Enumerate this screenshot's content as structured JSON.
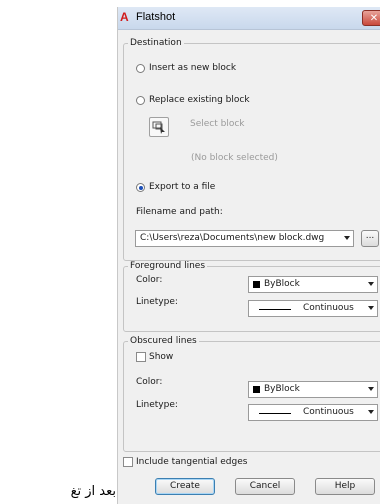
{
  "window": {
    "title": "Flatshot",
    "app_icon": "autocad-icon",
    "close_icon": "close-icon"
  },
  "destination": {
    "label": "Destination",
    "insert_new": "Insert as new block",
    "replace_existing": "Replace existing block",
    "select_block": "Select block",
    "no_block": "(No block selected)",
    "export_file": "Export to a file",
    "selected": "export_file",
    "filename_label": "Filename and path:",
    "filename_value": "C:\\Users\\reza\\Documents\\new block.dwg",
    "browse_label": "..."
  },
  "foreground": {
    "label": "Foreground lines",
    "color_label": "Color:",
    "color_value": "ByBlock",
    "linetype_label": "Linetype:",
    "linetype_value": "Continuous"
  },
  "obscured": {
    "label": "Obscured lines",
    "show_label": "Show",
    "show_checked": false,
    "color_label": "Color:",
    "color_value": "ByBlock",
    "linetype_label": "Linetype:",
    "linetype_value": "Continuous"
  },
  "options": {
    "include_tangential": "Include tangential edges",
    "include_tangential_checked": false
  },
  "buttons": {
    "create": "Create",
    "cancel": "Cancel",
    "help": "Help"
  },
  "page_text": "بعد از تغ",
  "colors": {
    "title_bar": "#c9d8ec",
    "close": "#c9483b",
    "accent": "#1c4fb8"
  }
}
